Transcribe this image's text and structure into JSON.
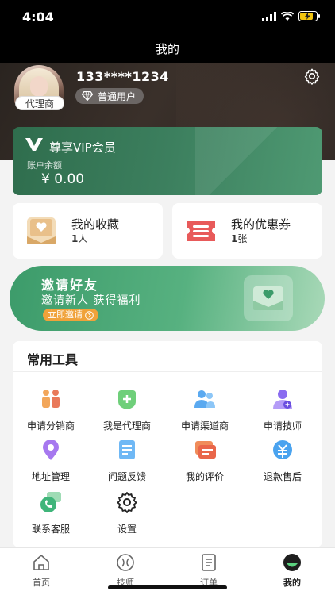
{
  "status": {
    "time": "4:04"
  },
  "nav": {
    "title": "我的"
  },
  "profile": {
    "agent_tag": "代理商",
    "phone": "133****1234",
    "level": "普通用户"
  },
  "vip": {
    "title": "尊享VIP会员",
    "balance_label": "账户余额",
    "balance": "¥ 0.00"
  },
  "favorites": {
    "title": "我的收藏",
    "count": "1",
    "unit": "人"
  },
  "coupons": {
    "title": "我的优惠券",
    "count": "1",
    "unit": "张"
  },
  "invite": {
    "title": "邀请好友",
    "subtitle": "邀请新人 获得福利",
    "button": "立即邀请"
  },
  "tools": {
    "title": "常用工具",
    "items": [
      {
        "label": "申请分销商",
        "icon": "distributor-icon"
      },
      {
        "label": "我是代理商",
        "icon": "agent-icon"
      },
      {
        "label": "申请渠道商",
        "icon": "channel-icon"
      },
      {
        "label": "申请技师",
        "icon": "technician-icon"
      },
      {
        "label": "地址管理",
        "icon": "location-icon"
      },
      {
        "label": "问题反馈",
        "icon": "feedback-icon"
      },
      {
        "label": "我的评价",
        "icon": "review-icon"
      },
      {
        "label": "退款售后",
        "icon": "refund-icon"
      },
      {
        "label": "联系客服",
        "icon": "customer-service-icon"
      },
      {
        "label": "设置",
        "icon": "settings-icon"
      }
    ]
  },
  "tabbar": {
    "items": [
      {
        "label": "首页",
        "icon": "home-icon"
      },
      {
        "label": "技师",
        "icon": "technician-tab-icon"
      },
      {
        "label": "订单",
        "icon": "order-icon"
      },
      {
        "label": "我的",
        "icon": "profile-tab-icon",
        "active": true
      }
    ]
  },
  "colors": {
    "accent_green": "#3c8f63",
    "dark_header": "#2a2420",
    "orange": "#f0a23a"
  }
}
